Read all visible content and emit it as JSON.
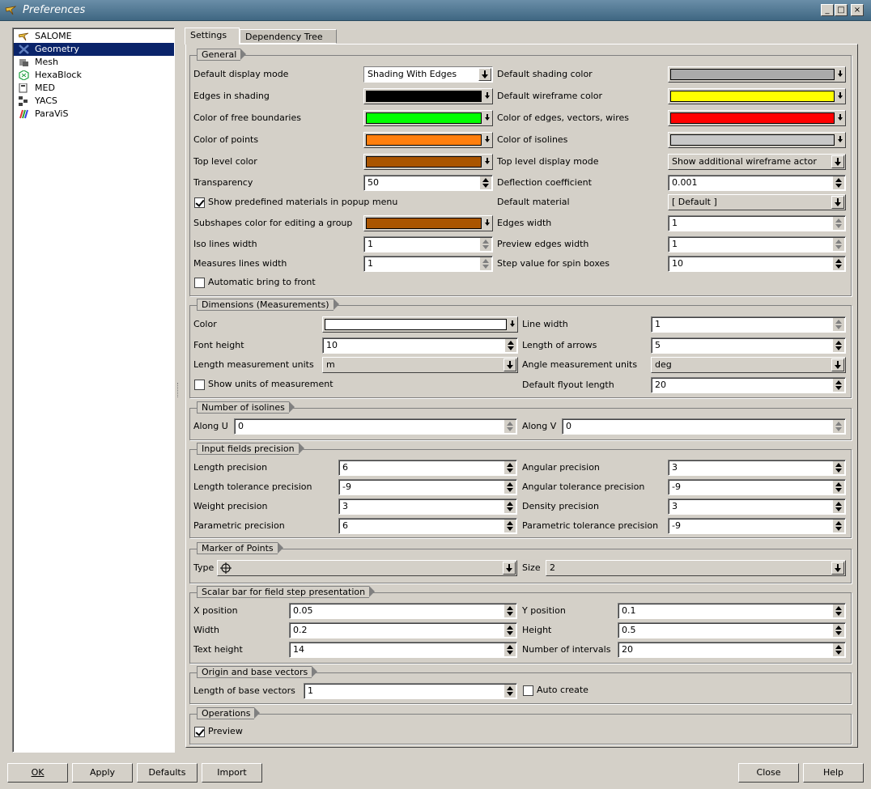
{
  "window": {
    "title": "Preferences",
    "min": "_",
    "max": "□",
    "close": "×"
  },
  "tree": {
    "items": [
      "SALOME",
      "Geometry",
      "Mesh",
      "HexaBlock",
      "MED",
      "YACS",
      "ParaViS"
    ],
    "selected": "Geometry"
  },
  "tabs": [
    "Settings",
    "Dependency Tree"
  ],
  "general": {
    "title": "General",
    "default_display_mode": {
      "label": "Default display mode",
      "value": "Shading With Edges"
    },
    "default_shading_color": {
      "label": "Default shading color",
      "color": "#aaaaaa"
    },
    "edges_in_shading": {
      "label": "Edges in shading",
      "color": "#000000"
    },
    "default_wireframe_color": {
      "label": "Default wireframe color",
      "color": "#ffff00"
    },
    "color_free_boundaries": {
      "label": "Color of free boundaries",
      "color": "#00ff00"
    },
    "color_edges": {
      "label": "Color of edges, vectors, wires",
      "color": "#ff0000"
    },
    "color_points": {
      "label": "Color of points",
      "color": "#ff7f0e"
    },
    "color_isolines": {
      "label": "Color of isolines",
      "color": "#c8c8c8"
    },
    "top_level_color": {
      "label": "Top level color",
      "color": "#aa5500"
    },
    "top_level_display_mode": {
      "label": "Top level display mode",
      "value": "Show additional wireframe actor"
    },
    "transparency": {
      "label": "Transparency",
      "value": "50"
    },
    "deflection": {
      "label": "Deflection coefficient",
      "value": "0.001"
    },
    "show_predefined": {
      "label": "Show predefined materials in popup menu",
      "checked": true
    },
    "default_material": {
      "label": "Default material",
      "value": "[ Default ]"
    },
    "subshapes_color": {
      "label": "Subshapes color for editing a group",
      "color": "#aa5500"
    },
    "edges_width": {
      "label": "Edges width",
      "value": "1"
    },
    "iso_lines_width": {
      "label": "Iso lines width",
      "value": "1"
    },
    "preview_edges_width": {
      "label": "Preview edges width",
      "value": "1"
    },
    "measures_lines_width": {
      "label": "Measures lines width",
      "value": "1"
    },
    "step_value": {
      "label": "Step value for spin boxes",
      "value": "10"
    },
    "auto_bring": {
      "label": "Automatic bring to front",
      "checked": false
    }
  },
  "dimensions": {
    "title": "Dimensions (Measurements)",
    "color": {
      "label": "Color",
      "color": "#ffffff"
    },
    "line_width": {
      "label": "Line width",
      "value": "1"
    },
    "font_height": {
      "label": "Font height",
      "value": "10"
    },
    "length_arrows": {
      "label": "Length of arrows",
      "value": "5"
    },
    "length_units": {
      "label": "Length measurement units",
      "value": "m"
    },
    "angle_units": {
      "label": "Angle measurement units",
      "value": "deg"
    },
    "show_units": {
      "label": "Show units of measurement",
      "checked": false
    },
    "flyout": {
      "label": "Default flyout length",
      "value": "20"
    }
  },
  "isolines": {
    "title": "Number of isolines",
    "along_u": {
      "label": "Along U",
      "value": "0"
    },
    "along_v": {
      "label": "Along V",
      "value": "0"
    }
  },
  "precision": {
    "title": "Input fields precision",
    "length": {
      "label": "Length precision",
      "value": "6"
    },
    "angular": {
      "label": "Angular precision",
      "value": "3"
    },
    "length_tol": {
      "label": "Length tolerance precision",
      "value": "-9"
    },
    "angular_tol": {
      "label": "Angular tolerance precision",
      "value": "-9"
    },
    "weight": {
      "label": "Weight precision",
      "value": "3"
    },
    "density": {
      "label": "Density precision",
      "value": "3"
    },
    "parametric": {
      "label": "Parametric precision",
      "value": "6"
    },
    "parametric_tol": {
      "label": "Parametric tolerance precision",
      "value": "-9"
    }
  },
  "marker": {
    "title": "Marker of Points",
    "type": {
      "label": "Type"
    },
    "size": {
      "label": "Size",
      "value": "2"
    }
  },
  "scalar": {
    "title": "Scalar bar for field step presentation",
    "x": {
      "label": "X position",
      "value": "0.05"
    },
    "y": {
      "label": "Y position",
      "value": "0.1"
    },
    "width": {
      "label": "Width",
      "value": "0.2"
    },
    "height": {
      "label": "Height",
      "value": "0.5"
    },
    "text_height": {
      "label": "Text height",
      "value": "14"
    },
    "intervals": {
      "label": "Number of intervals",
      "value": "20"
    }
  },
  "origin": {
    "title": "Origin and base vectors",
    "length": {
      "label": "Length of base vectors",
      "value": "1"
    },
    "auto_create": {
      "label": "Auto create",
      "checked": false
    }
  },
  "operations": {
    "title": "Operations",
    "preview": {
      "label": "Preview",
      "checked": true
    }
  },
  "buttons": {
    "ok": "OK",
    "apply": "Apply",
    "defaults": "Defaults",
    "import": "Import",
    "close": "Close",
    "help": "Help"
  }
}
